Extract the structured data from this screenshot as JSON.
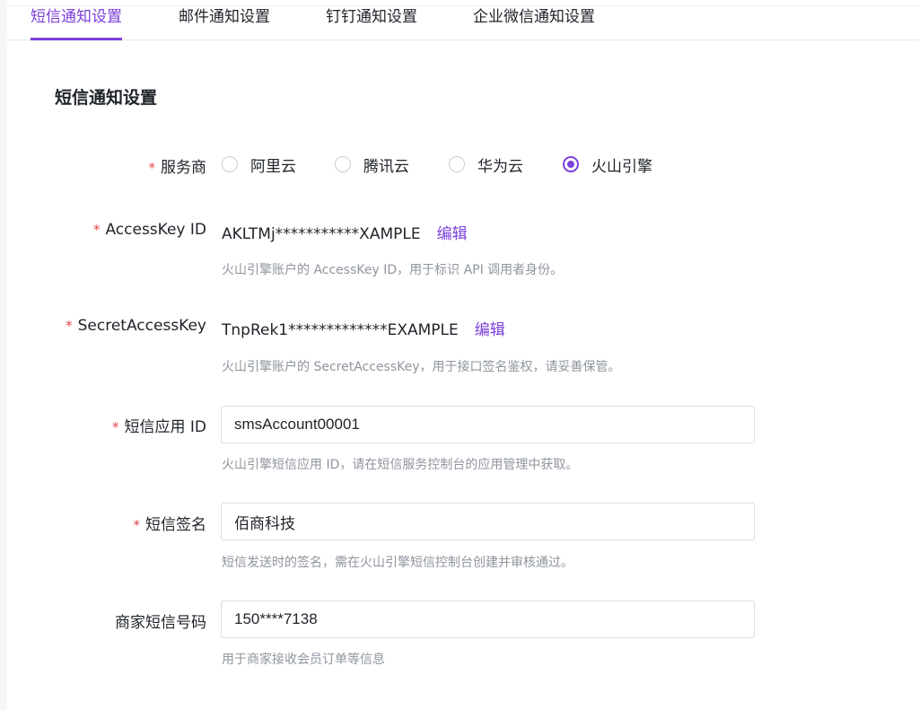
{
  "tabs": [
    {
      "label": "短信通知设置",
      "active": true
    },
    {
      "label": "邮件通知设置",
      "active": false
    },
    {
      "label": "钉钉通知设置",
      "active": false
    },
    {
      "label": "企业微信通知设置",
      "active": false
    }
  ],
  "section_title": "短信通知设置",
  "required_mark": "*",
  "provider": {
    "label": "服务商",
    "options": [
      "阿里云",
      "腾讯云",
      "华为云",
      "火山引擎"
    ],
    "selected": "火山引擎"
  },
  "access_key_id": {
    "label": "AccessKey ID",
    "value": "AKLTMj***********XAMPLE",
    "edit_label": "编辑",
    "hint": "火山引擎账户的 AccessKey ID，用于标识 API 调用者身份。"
  },
  "secret_access_key": {
    "label": "SecretAccessKey",
    "value": "TnpRek1*************EXAMPLE",
    "edit_label": "编辑",
    "hint": "火山引擎账户的 SecretAccessKey，用于接口签名鉴权，请妥善保管。"
  },
  "sms_app_id": {
    "label": "短信应用 ID",
    "value": "smsAccount00001",
    "hint": "火山引擎短信应用 ID，请在短信服务控制台的应用管理中获取。"
  },
  "sms_signature": {
    "label": "短信签名",
    "value": "佰商科技",
    "hint": "短信发送时的签名，需在火山引擎短信控制台创建并审核通过。"
  },
  "merchant_phone": {
    "label": "商家短信号码",
    "value": "150****7138",
    "hint": "用于商家接收会员订单等信息"
  },
  "colors": {
    "accent": "#7b3fd9",
    "required": "#e5484d",
    "hint_text": "#8f959e"
  }
}
